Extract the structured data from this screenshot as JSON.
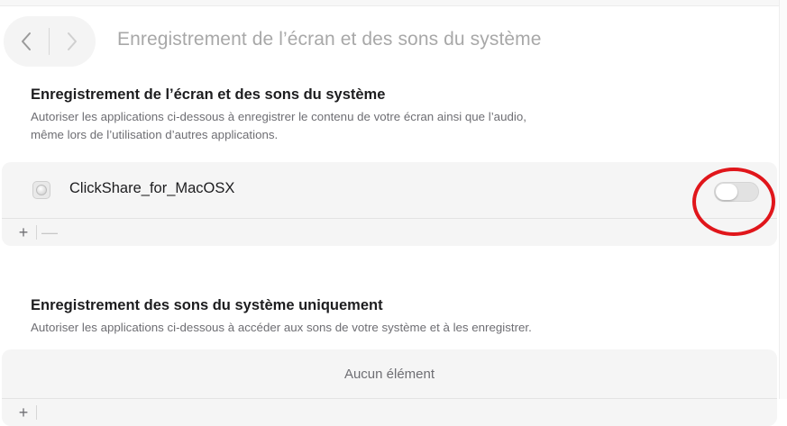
{
  "toolbar": {
    "title": "Enregistrement de l’écran et des sons du système",
    "back_icon": "chevron-left-icon",
    "forward_icon": "chevron-right-icon"
  },
  "section_screen": {
    "title": "Enregistrement de l’écran et des sons du système",
    "description_line1": "Autoriser les applications ci-dessous à enregistrer le contenu de votre écran ainsi que l’audio,",
    "description_line2": "même lors de l’utilisation d’autres applications.",
    "apps": [
      {
        "name": "ClickShare_for_MacOSX",
        "enabled": false
      }
    ],
    "add_label": "+",
    "remove_label": "—"
  },
  "section_audio": {
    "title": "Enregistrement des sons du système uniquement",
    "description": "Autoriser les applications ci-dessous à accéder aux sons de votre système et à les enregistrer.",
    "empty_text": "Aucun élément",
    "add_label": "+"
  },
  "colors": {
    "highlight": "#e0161b",
    "panel_bg": "#f5f5f5",
    "muted_text": "#6e6e73"
  }
}
